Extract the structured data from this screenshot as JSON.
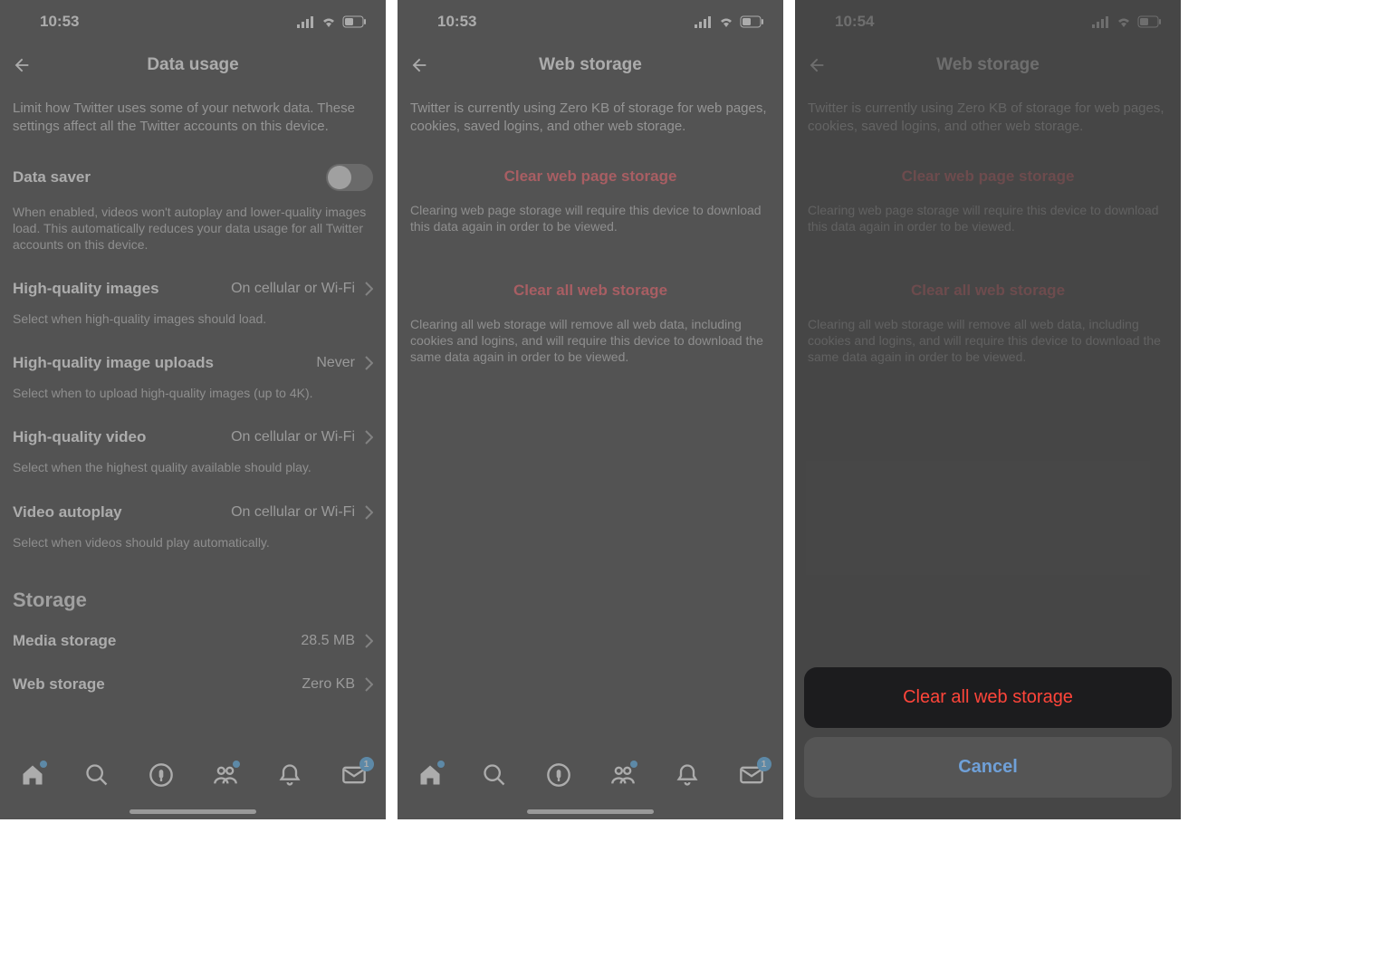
{
  "status": {
    "time_a": "10:53",
    "time_b": "10:53",
    "time_c": "10:54",
    "signal": "signal-icon",
    "wifi": "wifi-icon",
    "battery": "battery-icon"
  },
  "screen1": {
    "title": "Data usage",
    "intro": "Limit how Twitter uses some of your network data. These settings affect all the Twitter accounts on this device.",
    "data_saver": {
      "label": "Data saver",
      "desc": "When enabled, videos won't autoplay and lower-quality images load. This automatically reduces your data usage for all Twitter accounts on this device."
    },
    "rows": [
      {
        "label": "High-quality images",
        "value": "On cellular or Wi-Fi",
        "sub": "Select when high-quality images should load."
      },
      {
        "label": "High-quality image uploads",
        "value": "Never",
        "sub": "Select when to upload high-quality images (up to 4K)."
      },
      {
        "label": "High-quality video",
        "value": "On cellular or Wi-Fi",
        "sub": "Select when the highest quality available should play."
      },
      {
        "label": "Video autoplay",
        "value": "On cellular or Wi-Fi",
        "sub": "Select when videos should play automatically."
      }
    ],
    "storage_heading": "Storage",
    "storage": [
      {
        "label": "Media storage",
        "value": "28.5 MB"
      },
      {
        "label": "Web storage",
        "value": "Zero KB"
      }
    ]
  },
  "screen2": {
    "title": "Web storage",
    "intro": "Twitter is currently using Zero KB of storage for web pages, cookies, saved logins, and other web storage.",
    "clear_page": {
      "label": "Clear web page storage",
      "desc": "Clearing web page storage will require this device to download this data again in order to be viewed."
    },
    "clear_all": {
      "label": "Clear all web storage",
      "desc": "Clearing all web storage will remove all web data, including cookies and logins, and will require this device to download the same data again in order to be viewed."
    }
  },
  "screen3": {
    "title": "Web storage",
    "sheet_clear": "Clear all web storage",
    "sheet_cancel": "Cancel"
  },
  "tabs": {
    "badge": "1"
  }
}
